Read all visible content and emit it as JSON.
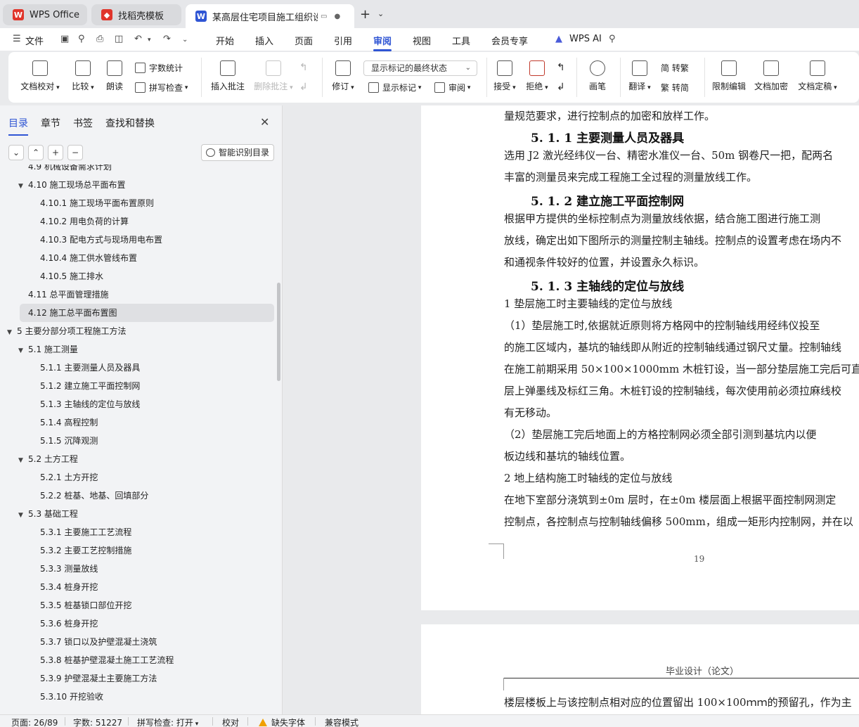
{
  "window": {
    "tabs": [
      {
        "label": "WPS Office",
        "icon": "wps-logo-icon",
        "color": "#e0352b"
      },
      {
        "label": "找稻壳模板",
        "icon": "docer-logo-icon",
        "color": "#e0352b"
      },
      {
        "label": "某高层住宅项目施工组织设计.",
        "icon": "wps-writer-icon",
        "color": "#2f55d4"
      }
    ],
    "new_tab": "+"
  },
  "menu": {
    "file": "文件",
    "items": [
      "开始",
      "插入",
      "页面",
      "引用",
      "审阅",
      "视图",
      "工具",
      "会员专享"
    ],
    "active": "审阅",
    "ai": "WPS AI"
  },
  "ribbon": {
    "doc_proof": "文档校对",
    "compare": "比较",
    "read_aloud": "朗读",
    "word_count": "字数统计",
    "spell_check": "拼写检查",
    "insert_comment": "插入批注",
    "delete_comment": "删除批注",
    "track_changes": "修订",
    "display_state": "显示标记的最终状态",
    "show_markup": "显示标记",
    "review_pane": "审阅",
    "accept": "接受",
    "reject": "拒绝",
    "pen": "画笔",
    "translate": "翻译",
    "to_traditional": "简 转繁",
    "to_simplified": "繁 转简",
    "restrict_edit": "限制编辑",
    "encrypt": "文档加密",
    "finalize": "文档定稿"
  },
  "nav": {
    "tabs": [
      "目录",
      "章节",
      "书签",
      "查找和替换"
    ],
    "active_tab": "目录",
    "smart_toc": "智能识别目录",
    "toc": [
      {
        "label": "4.9 机械设备需求计划",
        "level": 2,
        "arrow": ""
      },
      {
        "label": "4.10 施工现场总平面布置",
        "level": 2,
        "arrow": "▼"
      },
      {
        "label": "4.10.1 施工现场平面布置原则",
        "level": 3,
        "arrow": ""
      },
      {
        "label": "4.10.2  用电负荷的计算",
        "level": 3,
        "arrow": ""
      },
      {
        "label": "4.10.3  配电方式与现场用电布置",
        "level": 3,
        "arrow": ""
      },
      {
        "label": "4.10.4  施工供水管线布置",
        "level": 3,
        "arrow": ""
      },
      {
        "label": "4.10.5  施工排水",
        "level": 3,
        "arrow": ""
      },
      {
        "label": "4.11  总平面管理措施",
        "level": 2,
        "arrow": ""
      },
      {
        "label": "4.12  施工总平面布置图",
        "level": 2,
        "arrow": "",
        "selected": true
      },
      {
        "label": "5  主要分部分项工程施工方法",
        "level": 1,
        "arrow": "▼"
      },
      {
        "label": "5.1  施工测量",
        "level": 2,
        "arrow": "▼"
      },
      {
        "label": "5.1.1 主要测量人员及器具",
        "level": 3,
        "arrow": ""
      },
      {
        "label": "5.1.2 建立施工平面控制网",
        "level": 3,
        "arrow": ""
      },
      {
        "label": "5.1.3 主轴线的定位与放线",
        "level": 3,
        "arrow": ""
      },
      {
        "label": "5.1.4  高程控制",
        "level": 3,
        "arrow": ""
      },
      {
        "label": "5.1.5 沉降观测",
        "level": 3,
        "arrow": ""
      },
      {
        "label": "5.2 土方工程",
        "level": 2,
        "arrow": "▼"
      },
      {
        "label": "5.2.1 土方开挖",
        "level": 3,
        "arrow": ""
      },
      {
        "label": "5.2.2  桩基、地基、回填部分",
        "level": 3,
        "arrow": ""
      },
      {
        "label": "5.3 基础工程",
        "level": 2,
        "arrow": "▼"
      },
      {
        "label": "5.3.1 主要施工工艺流程",
        "level": 3,
        "arrow": ""
      },
      {
        "label": "5.3.2  主要工艺控制措施",
        "level": 3,
        "arrow": ""
      },
      {
        "label": "5.3.3  测量放线",
        "level": 3,
        "arrow": ""
      },
      {
        "label": "5.3.4  桩身开挖",
        "level": 3,
        "arrow": ""
      },
      {
        "label": "5.3.5  桩基锁口部位开挖",
        "level": 3,
        "arrow": ""
      },
      {
        "label": "5.3.6  桩身开挖",
        "level": 3,
        "arrow": ""
      },
      {
        "label": "5.3.7  锁口以及护壁混凝土浇筑",
        "level": 3,
        "arrow": ""
      },
      {
        "label": "5.3.8  桩基护壁混凝土施工工艺流程",
        "level": 3,
        "arrow": ""
      },
      {
        "label": "5.3.9  护壁混凝土主要施工方法",
        "level": 3,
        "arrow": ""
      },
      {
        "label": "5.3.10 开挖验收",
        "level": 3,
        "arrow": ""
      }
    ]
  },
  "document": {
    "page1_lines": [
      {
        "type": "text",
        "text": "量规范要求，进行控制点的加密和放样工作。"
      },
      {
        "type": "head",
        "text": "5. 1. 1 主要测量人员及器具"
      },
      {
        "type": "text",
        "text": "    选用 J2 激光经纬仪一台、精密水准仪一台、50m 钢卷尺一把，配两名"
      },
      {
        "type": "text",
        "text": "丰富的测量员来完成工程施工全过程的测量放线工作。"
      },
      {
        "type": "head",
        "text": "5. 1. 2 建立施工平面控制网"
      },
      {
        "type": "text",
        "text": "    根据甲方提供的坐标控制点为测量放线依据，结合施工图进行施工测"
      },
      {
        "type": "text",
        "text": "放线，确定出如下图所示的测量控制主轴线。控制点的设置考虑在场内不"
      },
      {
        "type": "text",
        "text": "和通视条件较好的位置，并设置永久标识。"
      },
      {
        "type": "head",
        "text": "5. 1. 3 主轴线的定位与放线"
      },
      {
        "type": "text",
        "text": "    1 垫层施工时主要轴线的定位与放线"
      },
      {
        "type": "text",
        "text": "    （1）垫层施工时,依据就近原则将方格网中的控制轴线用经纬仪投至"
      },
      {
        "type": "text",
        "text": "的施工区域内，基坑的轴线即从附近的控制轴线通过钢尺丈量。控制轴线"
      },
      {
        "type": "text",
        "text": "在施工前期采用 50×100×1000mm 木桩钉设，当一部分垫层施工完后可直"
      },
      {
        "type": "text",
        "text": "层上弹墨线及标红三角。木桩钉设的控制轴线，每次使用前必须拉麻线校"
      },
      {
        "type": "text",
        "text": "有无移动。"
      },
      {
        "type": "text",
        "text": "    （2）垫层施工完后地面上的方格控制网必须全部引测到基坑内以便"
      },
      {
        "type": "text",
        "text": "板边线和基坑的轴线位置。"
      },
      {
        "type": "text",
        "text": "    2 地上结构施工时轴线的定位与放线"
      },
      {
        "type": "text",
        "text": "    在地下室部分浇筑到±0m 层时，在±0m 楼层面上根据平面控制网测定"
      },
      {
        "type": "text",
        "text": "控制点，各控制点与控制轴线偏移 500mm，组成一矩形内控制网，并在以"
      }
    ],
    "page_number": "19",
    "page2_header": "毕业设计（论文）",
    "page2_line": "楼层楼板上与该控制点相对应的位置留出 100×100ｍｍ的预留孔，作为主"
  },
  "status": {
    "page": "页面: 26/89",
    "words": "字数: 51227",
    "spell": "拼写检查: 打开",
    "proof": "校对",
    "missing_font": "缺失字体",
    "compat": "兼容模式"
  }
}
